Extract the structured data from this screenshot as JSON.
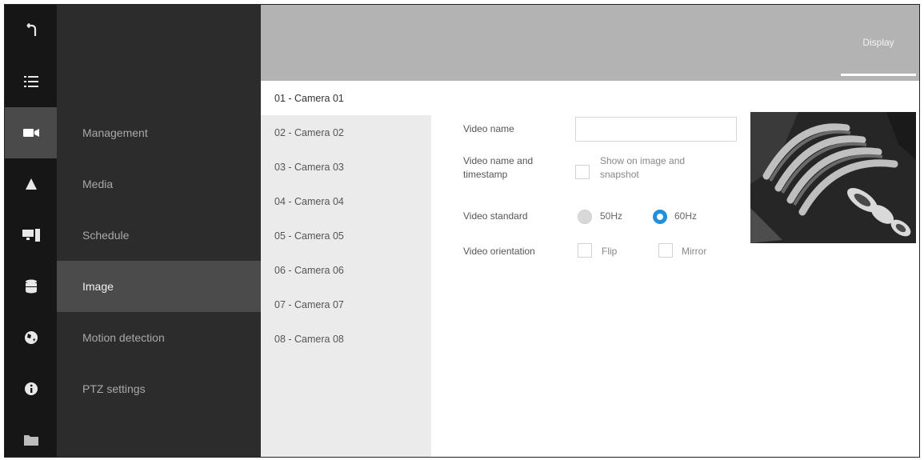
{
  "rail": {
    "icons": [
      "back-icon",
      "list-icon",
      "camera-icon",
      "alarm-icon",
      "display-monitor-icon",
      "storage-icon",
      "network-icon",
      "info-icon",
      "folder-icon"
    ]
  },
  "menu": {
    "items": [
      {
        "label": "Management",
        "active": false
      },
      {
        "label": "Media",
        "active": false
      },
      {
        "label": "Schedule",
        "active": false
      },
      {
        "label": "Image",
        "active": true
      },
      {
        "label": "Motion detection",
        "active": false
      },
      {
        "label": "PTZ settings",
        "active": false
      }
    ]
  },
  "topbar": {
    "tab_label": "Display"
  },
  "cameras": {
    "items": [
      "01 - Camera 01",
      "02 - Camera 02",
      "03 - Camera 03",
      "04 - Camera 04",
      "05 - Camera 05",
      "06 - Camera 06",
      "07 - Camera 07",
      "08 - Camera 08"
    ],
    "selected": 0
  },
  "form": {
    "video_name_label": "Video name",
    "video_name_value": "",
    "timestamp_label_line1": "Video name and",
    "timestamp_label_line2": "timestamp",
    "timestamp_option_line1": "Show on image and",
    "timestamp_option_line2": "snapshot",
    "standard_label": "Video standard",
    "standard_option_a": "50Hz",
    "standard_option_b": "60Hz",
    "standard_selected": "60Hz",
    "orientation_label": "Video orientation",
    "orientation_flip": "Flip",
    "orientation_mirror": "Mirror"
  },
  "colors": {
    "rail_bg": "#161616",
    "menu_bg": "#2c2c2c",
    "menu_active_bg": "#4b4b4b",
    "topbar_bg": "#b3b3b3",
    "camera_list_bg": "#ebebeb",
    "radio_accent": "#1e90e0"
  }
}
